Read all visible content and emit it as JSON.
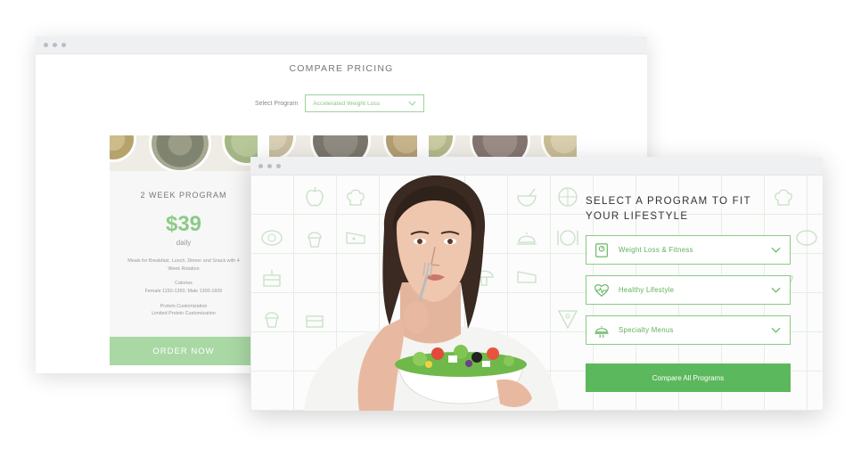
{
  "back_window": {
    "title": "COMPARE PRICING",
    "select_label": "Select Program",
    "select_value": "Accelerated Weight Loss",
    "cards": [
      {
        "plan": "2 WEEK PROGRAM",
        "price": "$39",
        "frequency": "daily",
        "desc_meals": "Meals for Breakfast, Lunch, Dinner and Snack with 4 Week Rotation",
        "desc_calories_label": "Calories",
        "desc_calories": "Female 1150-1350, Male 1300-1600",
        "desc_custom_1": "Protein Customization",
        "desc_custom_2": "Limited Protein Customization",
        "cta": "ORDER NOW"
      }
    ]
  },
  "front_window": {
    "heading": "SELECT A PROGRAM TO FIT YOUR LIFESTYLE",
    "accordions": [
      {
        "label": "Weight Loss & Fitness",
        "icon": "scale-icon"
      },
      {
        "label": "Healthy Lifestyle",
        "icon": "heartbeat-icon"
      },
      {
        "label": "Specialty Menus",
        "icon": "cloche-icon"
      }
    ],
    "cta": "Compare All Programs"
  },
  "colors": {
    "accent": "#5cb85c",
    "accent_light": "#a9d8a5",
    "price": "#8ccb86",
    "accordion_text": "#5fb158"
  }
}
